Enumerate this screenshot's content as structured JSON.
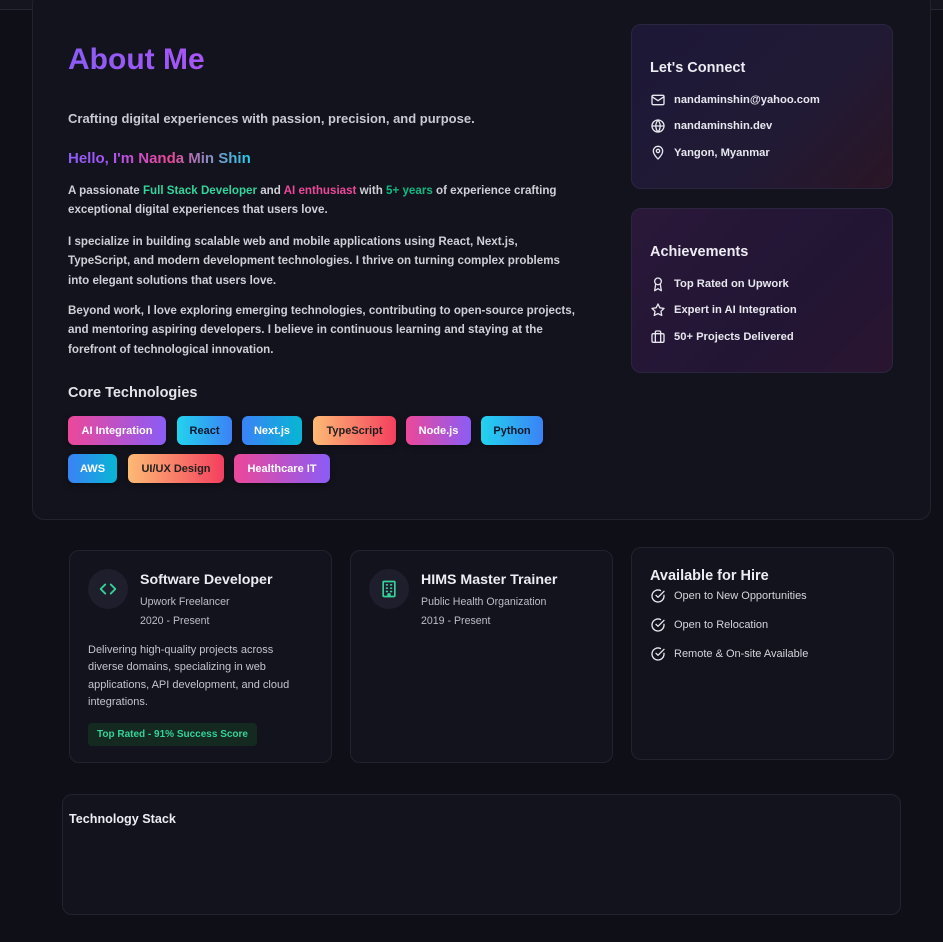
{
  "about": {
    "title": "About Me",
    "tagline": "Crafting digital experiences with passion, precision, and purpose.",
    "hello": "Hello, I'm Nanda Min Shin",
    "intro": {
      "pre": "A passionate ",
      "role": "Full Stack Developer",
      "and": " and ",
      "ai": "AI enthusiast",
      "with": " with ",
      "years": "5+ years",
      "post": " of experience crafting exceptional digital experiences that users love."
    },
    "para2": "I specialize in building scalable web and mobile applications using React, Next.js, TypeScript, and modern development technologies. I thrive on turning complex problems into elegant solutions that users love.",
    "para3": "Beyond work, I love exploring emerging technologies, contributing to open-source projects, and mentoring aspiring developers. I believe in continuous learning and staying at the forefront of technological innovation.",
    "core_title": "Core Technologies",
    "tags": [
      "AI Integration",
      "React",
      "Next.js",
      "TypeScript",
      "Node.js",
      "Python",
      "AWS",
      "UI/UX Design",
      "Healthcare IT"
    ]
  },
  "connect": {
    "title": "Let's Connect",
    "email": "nandaminshin@yahoo.com",
    "website": "nandaminshin.dev",
    "location": "Yangon, Myanmar"
  },
  "achievements": {
    "title": "Achievements",
    "items": [
      "Top Rated on Upwork",
      "Expert in AI Integration",
      "50+ Projects Delivered"
    ]
  },
  "experience": [
    {
      "title": "Software Developer",
      "org": "Upwork Freelancer",
      "period": "2020 - Present",
      "desc": "Delivering high-quality projects across diverse domains, specializing in web applications, API development, and cloud integrations.",
      "badge": "Top Rated - 91% Success Score",
      "icon": "code-icon"
    },
    {
      "title": "HIMS Master Trainer",
      "org": "Public Health Organization",
      "period": "2019 - Present",
      "icon": "building-icon"
    }
  ],
  "hire": {
    "title": "Available for Hire",
    "items": [
      "Open to New Opportunities",
      "Open to Relocation",
      "Remote & On-site Available"
    ]
  },
  "stack": {
    "title": "Technology Stack"
  },
  "colors": {
    "accent": "#8b5cf6",
    "green": "#34d399",
    "pink": "#ec4899"
  }
}
